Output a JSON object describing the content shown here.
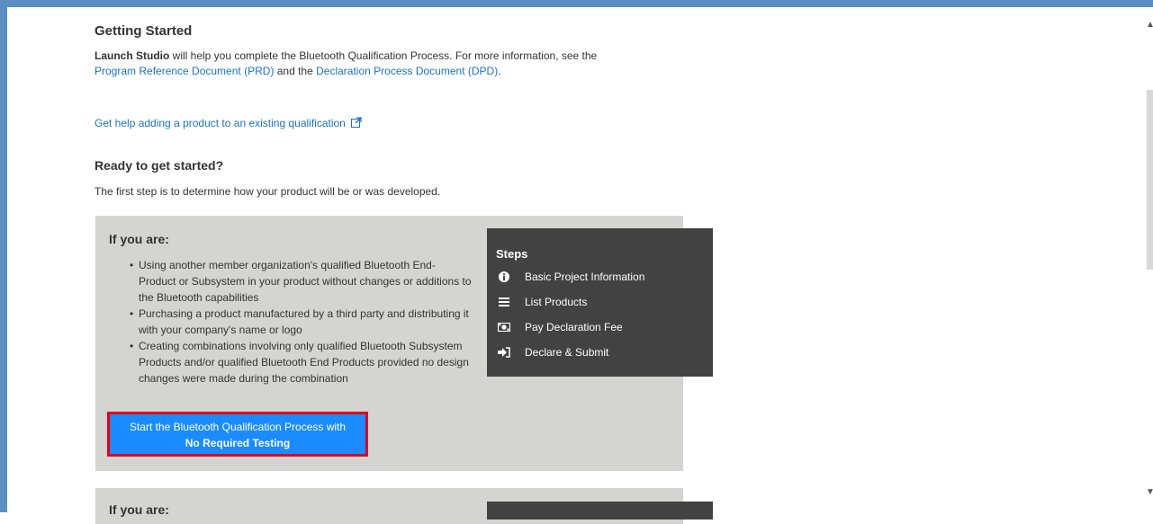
{
  "getting_started": {
    "title": "Getting Started",
    "intro_bold": "Launch Studio",
    "intro_text_1": " will help you complete the Bluetooth Qualification Process. For more information, see the ",
    "prd_link": "Program Reference Document (PRD)",
    "intro_text_2": " and the ",
    "dpd_link": "Declaration Process Document (DPD)",
    "intro_text_3": ".",
    "help_link": "Get help adding a product to an existing qualification"
  },
  "ready": {
    "title": "Ready to get started?",
    "text": "The first step is to determine how your product will be or was developed."
  },
  "option1": {
    "heading": "If you are:",
    "bullets": [
      "Using another member organization's qualified Bluetooth End-Product or Subsystem in your product without changes or additions to the Bluetooth capabilities",
      "Purchasing a product manufactured by a third party and distributing it with your company's name or logo",
      "Creating combinations involving only qualified Bluetooth Subsystem Products and/or qualified Bluetooth End Products provided no design changes were made during the combination"
    ],
    "button_line1": "Start the Bluetooth Qualification Process with",
    "button_line2": "No Required Testing"
  },
  "steps": {
    "title": "Steps",
    "items": [
      {
        "icon": "info-icon",
        "label": "Basic Project Information"
      },
      {
        "icon": "list-icon",
        "label": "List Products"
      },
      {
        "icon": "money-icon",
        "label": "Pay Declaration Fee"
      },
      {
        "icon": "sign-in-icon",
        "label": "Declare & Submit"
      }
    ]
  },
  "option2": {
    "heading": "If you are:"
  },
  "colors": {
    "frame": "#5b8fc4",
    "card": "#d4d4d1",
    "steps_panel": "#424242",
    "button": "#1a8cff",
    "button_highlight": "#e3001b",
    "link": "#1a73c9"
  }
}
